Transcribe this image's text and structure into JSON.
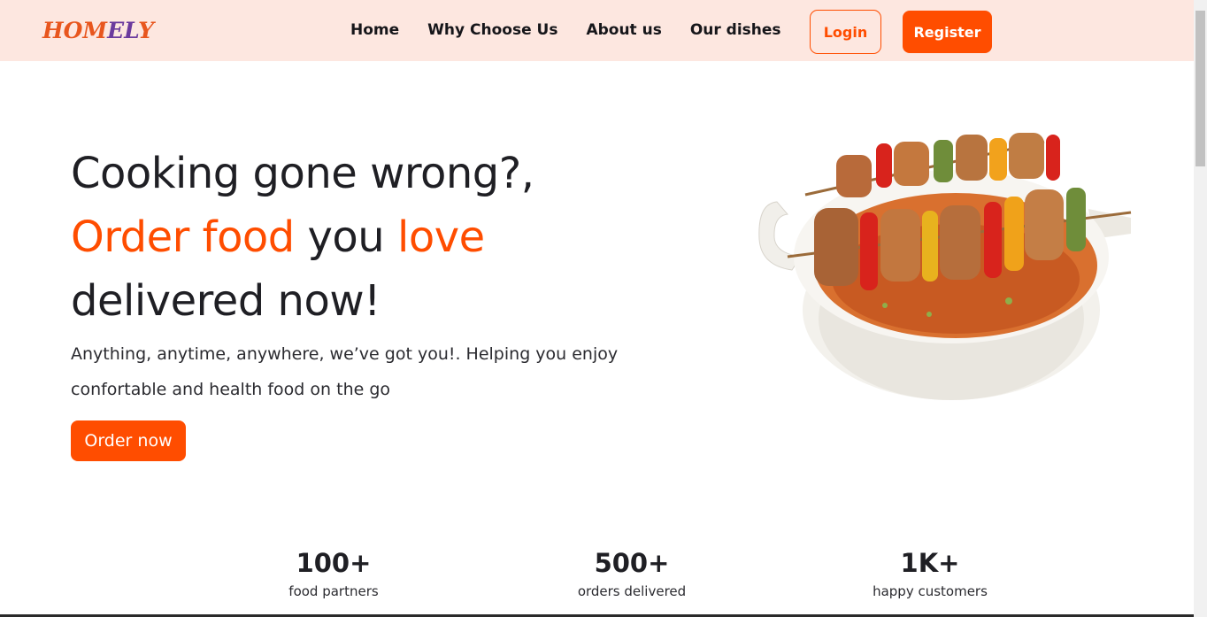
{
  "brand": {
    "logo_part1": "HOM",
    "logo_part2": "EL",
    "logo_part3": "Y"
  },
  "nav": {
    "links": [
      "Home",
      "Why Choose Us",
      "About us",
      "Our dishes"
    ],
    "login_label": "Login",
    "register_label": "Register"
  },
  "hero": {
    "title_line1": "Cooking gone wrong?,",
    "title_accent1": "Order food",
    "title_mid": " you ",
    "title_accent2": "love",
    "title_line3": "delivered now!",
    "subtitle": "Anything, anytime, anywhere, we’ve got you!. Helping you enjoy confortable and health food on the go",
    "cta_label": "Order now",
    "image_icon": "food-bowl-image"
  },
  "stats": [
    {
      "value": "100+",
      "label": "food partners"
    },
    {
      "value": "500+",
      "label": "orders delivered"
    },
    {
      "value": "1K+",
      "label": "happy customers"
    }
  ],
  "colors": {
    "accent": "#ff4d00",
    "nav_bg": "#fde7e0",
    "text": "#1f1f24"
  }
}
